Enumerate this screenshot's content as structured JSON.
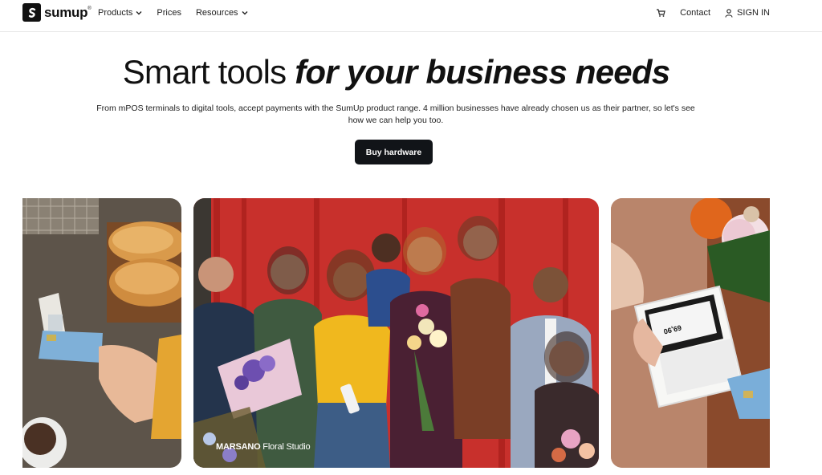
{
  "header": {
    "logo_text": "sumup",
    "nav": [
      {
        "label": "Products",
        "has_dropdown": true
      },
      {
        "label": "Prices",
        "has_dropdown": false
      },
      {
        "label": "Resources",
        "has_dropdown": true
      }
    ],
    "cart_icon": "cart-icon",
    "contact_label": "Contact",
    "signin_label": "SIGN IN",
    "signin_icon": "user-icon"
  },
  "hero": {
    "title_light": "Smart tools",
    "title_bold": "for your business needs",
    "subtitle": "From mPOS terminals to digital tools, accept payments with the SumUp product range. 4 million businesses have already chosen us as their partner, so let's see how we can help you too.",
    "cta_label": "Buy hardware"
  },
  "carousel": {
    "center_caption_brand": "MARSANO",
    "center_caption_rest": "Floral Studio",
    "terminal_amount": "69,90"
  },
  "colors": {
    "cta_bg": "#111418",
    "backdrop_red": "#c8302c",
    "text_dark": "#111111"
  }
}
